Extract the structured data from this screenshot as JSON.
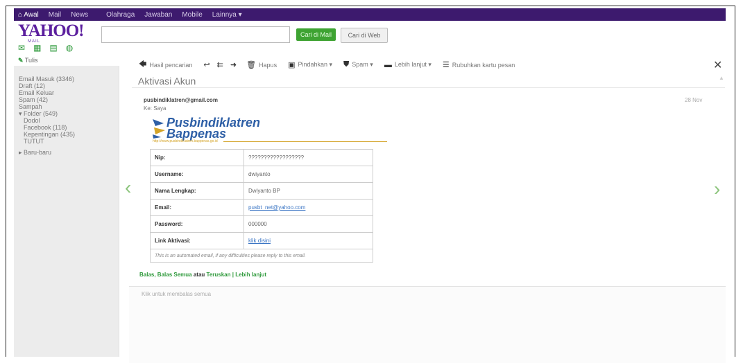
{
  "topbar": {
    "home": "Awal",
    "items": [
      "Mail",
      "News",
      "Olahraga",
      "Jawaban",
      "Mobile",
      "Lainnya ▾"
    ]
  },
  "logo": {
    "main": "YAHOO!",
    "sub": "MAIL"
  },
  "search": {
    "placeholder": "",
    "btn_mail": "Cari di Mail",
    "btn_web": "Cari di Web"
  },
  "compose": "Tulis",
  "sidebar": {
    "items": [
      "Email Masuk (3346)",
      "Draft (12)",
      "Email Keluar",
      "Spam (42)",
      "Sampah",
      "▾ Folder (549)",
      "Dodol",
      "Facebook (118)",
      "Kepentingan (435)",
      "TUTUT",
      "▸ Baru-baru"
    ]
  },
  "toolbar": {
    "back": "Hasil pencarian",
    "delete": "Hapus",
    "move": "Pindahkan ▾",
    "spam": "Spam ▾",
    "more": "Lebih lanjut ▾",
    "sort": "Rubuhkan kartu pesan"
  },
  "message": {
    "subject": "Aktivasi Akun",
    "sender": "pusbindiklatren@gmail.com",
    "to": "Ke: Saya",
    "date": "28 Nov",
    "logo_line1": "Pusbindiklatren",
    "logo_line2": "Bappenas",
    "logo_url": "http://www.pusbindiklatren.bappenas.go.id",
    "rows": [
      {
        "k": "Nip:",
        "v": "??????????????????"
      },
      {
        "k": "Username:",
        "v": "dwiyanto"
      },
      {
        "k": "Nama Lengkap:",
        "v": "Dwiyanto BP"
      },
      {
        "k": "Email:",
        "v": "pusbt_net@yahoo.com"
      },
      {
        "k": "Password:",
        "v": "000000"
      },
      {
        "k": "Link Aktivasi:",
        "v": "klik disini"
      }
    ],
    "note": "This is an automated email, if any difficulties please reply to this email."
  },
  "reply": {
    "a": "Balas, Balas Semua",
    "b": "atau",
    "c": "Teruskan | Lebih lanjut",
    "placeholder": "Klik untuk membalas semua"
  }
}
